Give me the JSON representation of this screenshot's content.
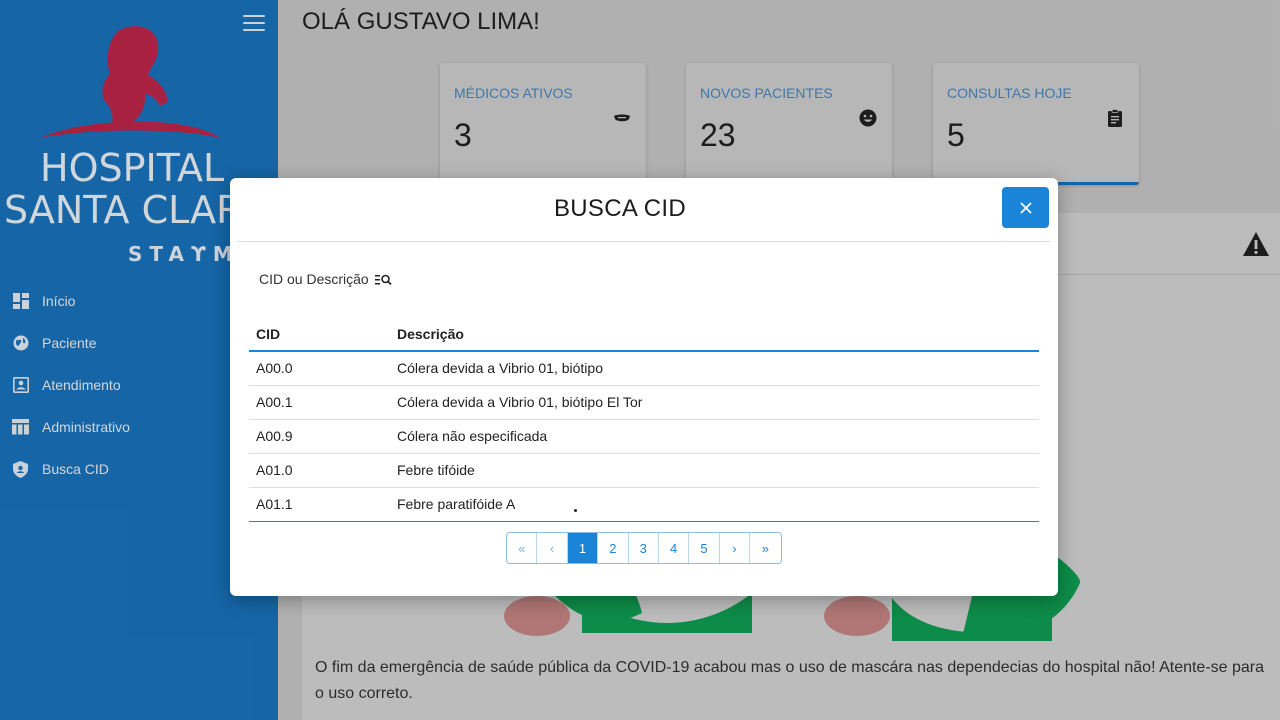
{
  "app": {
    "logo": {
      "line1": "HOSPITAL",
      "line2": "SANTA CLAR",
      "stamp": "STAϒM"
    },
    "colors": {
      "brand": "#1a74bd",
      "accent": "#1a84d8",
      "logo_red": "#c0264b"
    }
  },
  "sidebar": {
    "menu_icon": "hamburger-icon",
    "items": [
      {
        "label": "Início",
        "icon": "dashboard-icon"
      },
      {
        "label": "Paciente",
        "icon": "globe-icon"
      },
      {
        "label": "Atendimento",
        "icon": "contact-card-icon"
      },
      {
        "label": "Administrativo",
        "icon": "table-icon"
      },
      {
        "label": "Busca CID",
        "icon": "shield-icon"
      }
    ]
  },
  "header": {
    "greeting": "OLÁ GUSTAVO LIMA!"
  },
  "cards": [
    {
      "label": "MÉDICOS ATIVOS",
      "value": "3",
      "icon": "mask-icon"
    },
    {
      "label": "NOVOS PACIENTES",
      "value": "23",
      "icon": "smiley-icon"
    },
    {
      "label": "CONSULTAS HOJE",
      "value": "5",
      "icon": "clipboard-icon"
    }
  ],
  "notice": {
    "icon": "warning-icon",
    "message": "O fim da emergência de saúde pública da COVID-19 acabou mas o uso de mascára nas dependecias do hospital não! Atente-se para o uso correto."
  },
  "modal": {
    "title": "BUSCA CID",
    "close_icon": "close-icon",
    "search_label": "CID ou Descrição",
    "search_icon": "search-list-icon",
    "columns": [
      "CID",
      "Descrição"
    ],
    "rows": [
      {
        "cid": "A00.0",
        "desc": "Cólera devida a Vibrio 01, biótipo"
      },
      {
        "cid": "A00.1",
        "desc": "Cólera devida a Vibrio 01, biótipo El Tor"
      },
      {
        "cid": "A00.9",
        "desc": "Cólera não especificada"
      },
      {
        "cid": "A01.0",
        "desc": "Febre tifóide"
      },
      {
        "cid": "A01.1",
        "desc": "Febre paratifóide A"
      }
    ],
    "pagination": {
      "first": "«",
      "prev": "‹",
      "pages": [
        "1",
        "2",
        "3",
        "4",
        "5"
      ],
      "current": "1",
      "next": "›",
      "last": "»"
    }
  }
}
